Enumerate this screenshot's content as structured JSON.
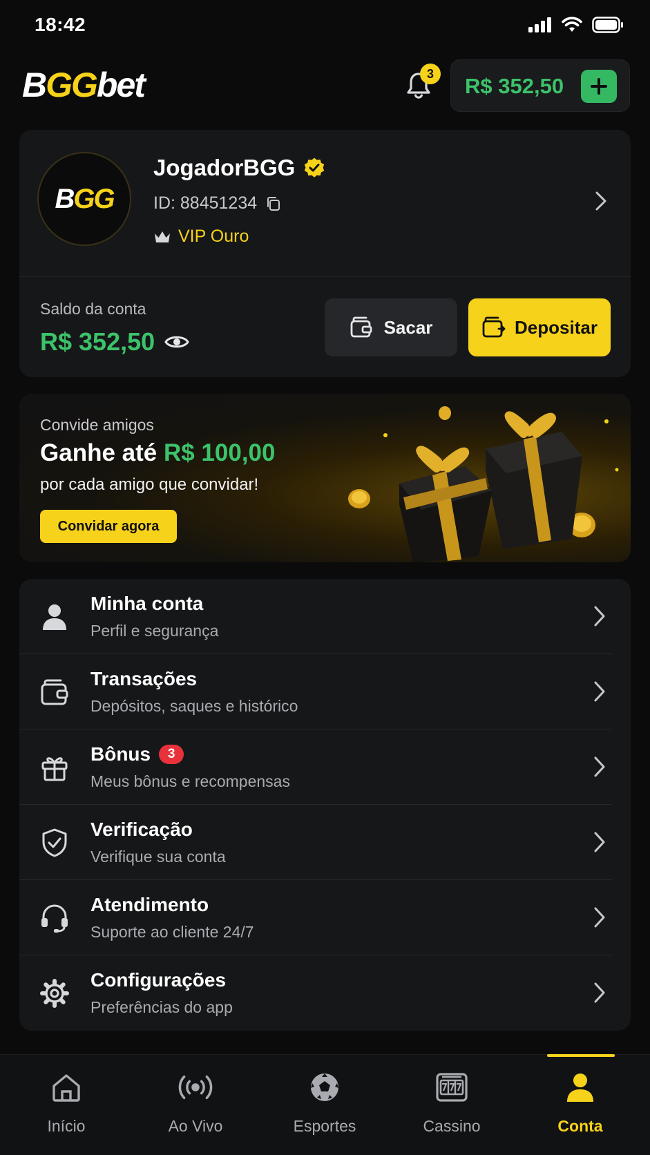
{
  "status_bar": {
    "time": "18:42"
  },
  "header": {
    "logo": {
      "part1": "B",
      "part2": "GG",
      "part3": "bet"
    },
    "notifications_count": "3",
    "balance": "R$ 352,50"
  },
  "profile": {
    "avatar_logo": {
      "part1": "B",
      "part2": "GG"
    },
    "username": "JogadorBGG",
    "id": "ID: 88451234",
    "vip_level": "VIP Ouro",
    "balance_label": "Saldo da conta",
    "balance_value": "R$ 352,50",
    "withdraw_label": "Sacar",
    "deposit_label": "Depositar"
  },
  "promo": {
    "subtitle": "Convide amigos",
    "title_prefix": "Ganhe até ",
    "title_amount": "R$ 100,00",
    "description": "por cada amigo que convidar!",
    "button": "Convidar agora"
  },
  "menu": [
    {
      "title": "Minha conta",
      "subtitle": "Perfil e segurança",
      "icon": "user-icon"
    },
    {
      "title": "Transações",
      "subtitle": "Depósitos, saques e histórico",
      "icon": "wallet-icon"
    },
    {
      "title": "Bônus",
      "subtitle": "Meus bônus e recompensas",
      "icon": "gift-icon",
      "badge": "3"
    },
    {
      "title": "Verificação",
      "subtitle": "Verifique sua conta",
      "icon": "shield-check-icon"
    },
    {
      "title": "Atendimento",
      "subtitle": "Suporte ao cliente 24/7",
      "icon": "headset-icon"
    },
    {
      "title": "Configurações",
      "subtitle": "Preferências do app",
      "icon": "gear-icon"
    }
  ],
  "bottom_nav": [
    {
      "label": "Início",
      "icon": "home-icon"
    },
    {
      "label": "Ao Vivo",
      "icon": "live-icon"
    },
    {
      "label": "Esportes",
      "icon": "soccer-ball-icon"
    },
    {
      "label": "Cassino",
      "icon": "slot-machine-icon"
    },
    {
      "label": "Conta",
      "icon": "user-icon",
      "active": true
    }
  ],
  "colors": {
    "accent_yellow": "#f7d21a",
    "accent_green": "#3cc36a",
    "background": "#0b0b0c",
    "card": "#161719",
    "badge_red": "#e8323b"
  }
}
